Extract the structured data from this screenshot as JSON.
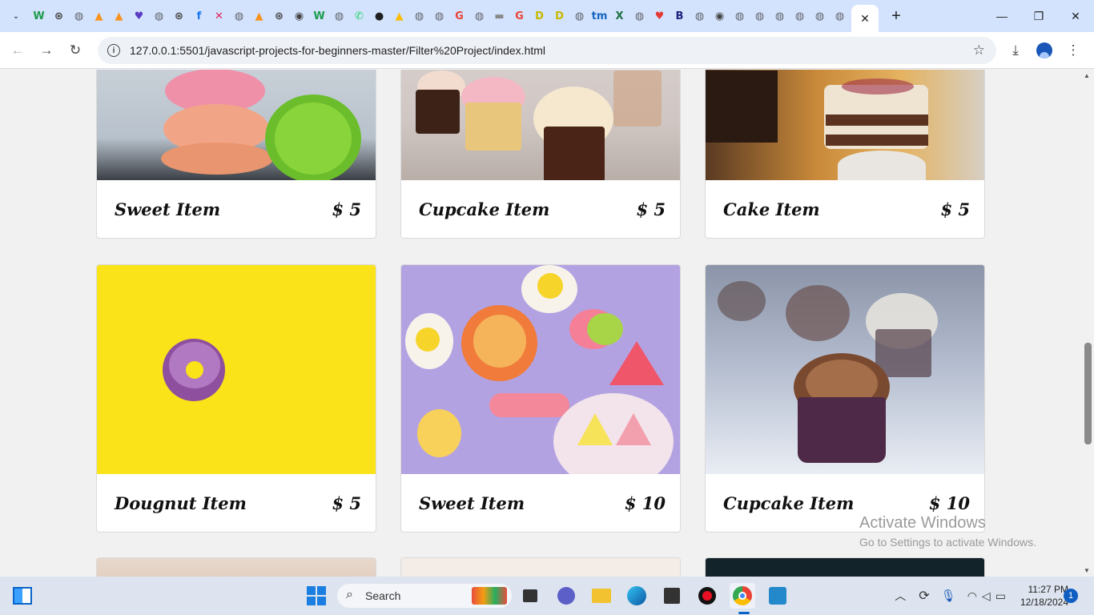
{
  "browser": {
    "active_tab_close": "✕",
    "new_tab": "+",
    "tab_menu": "⌄",
    "window_controls": {
      "minimize": "—",
      "maximize": "❐",
      "close": "✕"
    },
    "url": "127.0.0.1:5501/javascript-projects-for-beginners-master/Filter%20Project/index.html",
    "pinned_tabs": [
      {
        "icon": "w-icon",
        "glyph": "W",
        "color": "#1a9a4a"
      },
      {
        "icon": "chatgpt-icon",
        "glyph": "⊛",
        "color": "#444"
      },
      {
        "icon": "globe-icon",
        "glyph": "◍",
        "color": "#5f6368"
      },
      {
        "icon": "vlc-icon",
        "glyph": "▲",
        "color": "#f7931e"
      },
      {
        "icon": "vlc-icon",
        "glyph": "▲",
        "color": "#f7931e"
      },
      {
        "icon": "heart-chat-icon",
        "glyph": "♥",
        "color": "#5b3cc4"
      },
      {
        "icon": "globe-icon",
        "glyph": "◍",
        "color": "#5f6368"
      },
      {
        "icon": "chatgpt-icon",
        "glyph": "⊛",
        "color": "#444"
      },
      {
        "icon": "facebook-icon",
        "glyph": "f",
        "color": "#1877f2"
      },
      {
        "icon": "x-icon",
        "glyph": "✕",
        "color": "#e0245e"
      },
      {
        "icon": "globe-icon",
        "glyph": "◍",
        "color": "#5f6368"
      },
      {
        "icon": "vlc-icon",
        "glyph": "▲",
        "color": "#f7931e"
      },
      {
        "icon": "chatgpt-icon",
        "glyph": "⊛",
        "color": "#444"
      },
      {
        "icon": "chrome-icon",
        "glyph": "◉",
        "color": "#444"
      },
      {
        "icon": "w-icon",
        "glyph": "W",
        "color": "#1a9a4a"
      },
      {
        "icon": "globe-icon",
        "glyph": "◍",
        "color": "#5f6368"
      },
      {
        "icon": "whatsapp-icon",
        "glyph": "✆",
        "color": "#25d366"
      },
      {
        "icon": "github-icon",
        "glyph": "●",
        "color": "#1f1f1f"
      },
      {
        "icon": "drive-icon",
        "glyph": "▲",
        "color": "#fbbc04"
      },
      {
        "icon": "globe-icon",
        "glyph": "◍",
        "color": "#5f6368"
      },
      {
        "icon": "globe-icon",
        "glyph": "◍",
        "color": "#5f6368"
      },
      {
        "icon": "google-icon",
        "glyph": "G",
        "color": "#ea4335"
      },
      {
        "icon": "globe-icon",
        "glyph": "◍",
        "color": "#5f6368"
      },
      {
        "icon": "bar-icon",
        "glyph": "▬",
        "color": "#888"
      },
      {
        "icon": "google-icon",
        "glyph": "G",
        "color": "#ea4335"
      },
      {
        "icon": "dxl-icon",
        "glyph": "D",
        "color": "#c9b800"
      },
      {
        "icon": "dxl-icon",
        "glyph": "D",
        "color": "#c9b800"
      },
      {
        "icon": "globe-icon",
        "glyph": "◍",
        "color": "#5f6368"
      },
      {
        "icon": "tm-icon",
        "glyph": "tm",
        "color": "#1565c0"
      },
      {
        "icon": "excel-icon",
        "glyph": "X",
        "color": "#1e7145"
      },
      {
        "icon": "globe-icon",
        "glyph": "◍",
        "color": "#5f6368"
      },
      {
        "icon": "heart-icon",
        "glyph": "♥",
        "color": "#e53935"
      },
      {
        "icon": "bond-icon",
        "glyph": "B",
        "color": "#1a237e"
      },
      {
        "icon": "globe-icon",
        "glyph": "◍",
        "color": "#5f6368"
      },
      {
        "icon": "chrome-icon",
        "glyph": "◉",
        "color": "#444"
      },
      {
        "icon": "globe-icon",
        "glyph": "◍",
        "color": "#5f6368"
      },
      {
        "icon": "globe-icon",
        "glyph": "◍",
        "color": "#5f6368"
      },
      {
        "icon": "globe-icon",
        "glyph": "◍",
        "color": "#5f6368"
      },
      {
        "icon": "globe-icon",
        "glyph": "◍",
        "color": "#5f6368"
      },
      {
        "icon": "globe-icon",
        "glyph": "◍",
        "color": "#5f6368"
      },
      {
        "icon": "globe-icon",
        "glyph": "◍",
        "color": "#5f6368"
      }
    ]
  },
  "products": [
    {
      "name": "Sweet Item",
      "price": "$ 5",
      "image": "macaron"
    },
    {
      "name": "Cupcake Item",
      "price": "$ 5",
      "image": "cupcakes"
    },
    {
      "name": "Cake Item",
      "price": "$ 5",
      "image": "cake"
    },
    {
      "name": "Dougnut Item",
      "price": "$ 5",
      "image": "doughnut"
    },
    {
      "name": "Sweet Item",
      "price": "$ 10",
      "image": "candy"
    },
    {
      "name": "Cupcake Item",
      "price": "$ 10",
      "image": "chocolate-cupcake"
    }
  ],
  "watermark": {
    "line1": "Activate Windows",
    "line2": "Go to Settings to activate Windows."
  },
  "taskbar": {
    "search_placeholder": "Search",
    "time": "11:27 PM",
    "date": "12/18/2024",
    "notification_count": "1"
  }
}
